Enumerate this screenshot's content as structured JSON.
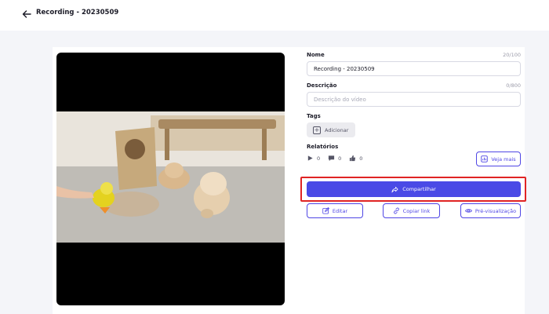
{
  "header": {
    "title": "Recording - 20230509",
    "back_icon": "arrow-left-icon"
  },
  "form": {
    "name_label": "Nome",
    "name_counter": "20/100",
    "name_value": "Recording - 20230509",
    "description_label": "Descrição",
    "description_counter": "0/800",
    "description_placeholder": "Descrição do vídeo",
    "tags_label": "Tags",
    "tags_add_label": "Adicionar"
  },
  "reports": {
    "label": "Relatórios",
    "views": "0",
    "comments": "0",
    "likes": "0",
    "see_more_label": "Veja mais"
  },
  "actions": {
    "share_label": "Compartilhar",
    "edit_label": "Editar",
    "copy_link_label": "Copiar link",
    "preview_label": "Pré-visualização"
  },
  "colors": {
    "accent": "#4a4ae6",
    "highlight": "#e02424"
  }
}
